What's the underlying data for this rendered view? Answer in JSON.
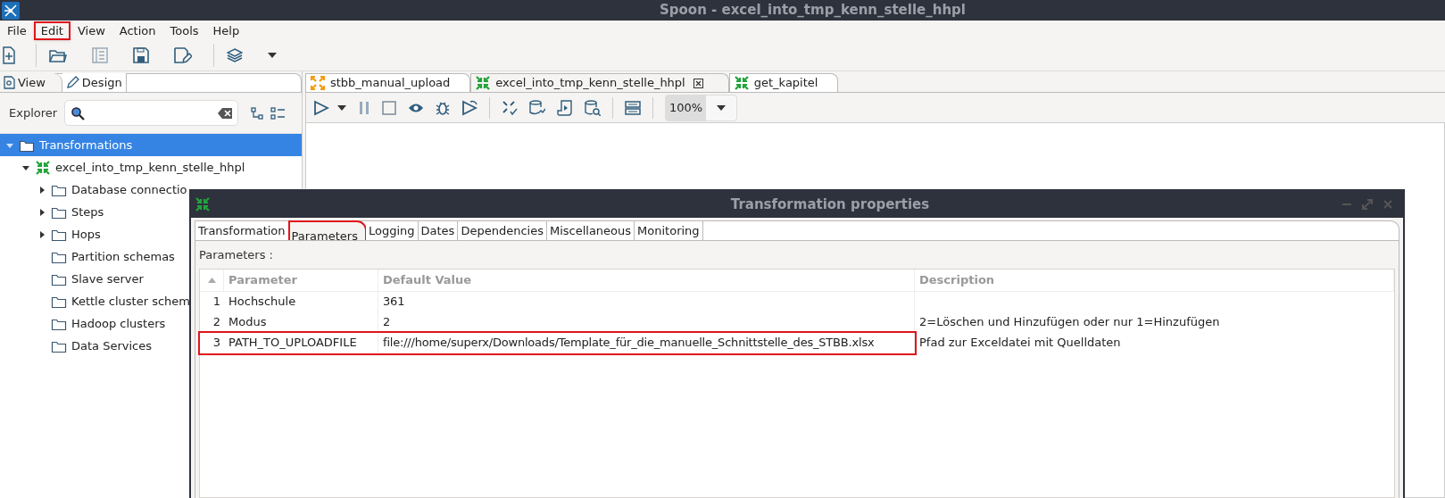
{
  "window": {
    "title": "Spoon - excel_into_tmp_kenn_stelle_hhpl"
  },
  "menu": [
    {
      "label": "File",
      "highlighted": false
    },
    {
      "label": "Edit",
      "highlighted": true
    },
    {
      "label": "View",
      "highlighted": false
    },
    {
      "label": "Action",
      "highlighted": false
    },
    {
      "label": "Tools",
      "highlighted": false
    },
    {
      "label": "Help",
      "highlighted": false
    }
  ],
  "left_tabs": [
    {
      "label": "View",
      "selected": true
    },
    {
      "label": "Design",
      "selected": false
    }
  ],
  "explorer": {
    "label": "Explorer"
  },
  "tree": [
    {
      "label": "Transformations",
      "kind": "folder",
      "selected": true,
      "expanded": true,
      "children": [
        {
          "label": "excel_into_tmp_kenn_stelle_hhpl",
          "kind": "transformation",
          "selected": false,
          "expanded": true,
          "children": [
            {
              "label": "Database connectio",
              "kind": "folder",
              "selected": false,
              "expanded": false
            },
            {
              "label": "Steps",
              "kind": "folder",
              "selected": false,
              "expanded": false
            },
            {
              "label": "Hops",
              "kind": "folder",
              "selected": false,
              "expanded": false
            },
            {
              "label": "Partition schemas",
              "kind": "folder",
              "selected": false
            },
            {
              "label": "Slave server",
              "kind": "folder",
              "selected": false
            },
            {
              "label": "Kettle cluster schem",
              "kind": "folder",
              "selected": false
            },
            {
              "label": "Hadoop clusters",
              "kind": "folder",
              "selected": false
            },
            {
              "label": "Data Services",
              "kind": "folder",
              "selected": false
            }
          ]
        }
      ]
    }
  ],
  "editor_tabs": [
    {
      "label": "stbb_manual_upload",
      "kind": "job",
      "selected": false
    },
    {
      "label": "excel_into_tmp_kenn_stelle_hhpl",
      "kind": "transformation",
      "selected": true
    },
    {
      "label": "get_kapitel",
      "kind": "transformation",
      "selected": false
    }
  ],
  "zoom": {
    "value": "100%"
  },
  "dialog": {
    "title": "Transformation properties",
    "tabs": [
      {
        "label": "Transformation",
        "selected": false,
        "highlighted": false
      },
      {
        "label": "Parameters",
        "selected": true,
        "highlighted": true
      },
      {
        "label": "Logging",
        "selected": false,
        "highlighted": false
      },
      {
        "label": "Dates",
        "selected": false,
        "highlighted": false
      },
      {
        "label": "Dependencies",
        "selected": false,
        "highlighted": false
      },
      {
        "label": "Miscellaneous",
        "selected": false,
        "highlighted": false
      },
      {
        "label": "Monitoring",
        "selected": false,
        "highlighted": false
      }
    ],
    "section_label": "Parameters :",
    "table": {
      "columns": [
        "Parameter",
        "Default Value",
        "Description"
      ],
      "rows": [
        {
          "index": "1",
          "parameter": "Hochschule",
          "default_value": "361",
          "highlighted": false
        },
        {
          "index": "2",
          "parameter": "Modus",
          "default_value": "2",
          "description": "2=Löschen und Hinzufügen oder nur 1=Hinzufügen",
          "highlighted": false
        },
        {
          "index": "3",
          "parameter": "PATH_TO_UPLOADFILE",
          "default_value": "file:///home/superx/Downloads/Template_für_die_manuelle_Schnittstelle_des_STBB.xlsx",
          "description": "Pfad zur  Exceldatei mit Quelldaten",
          "highlighted": true
        }
      ]
    }
  }
}
